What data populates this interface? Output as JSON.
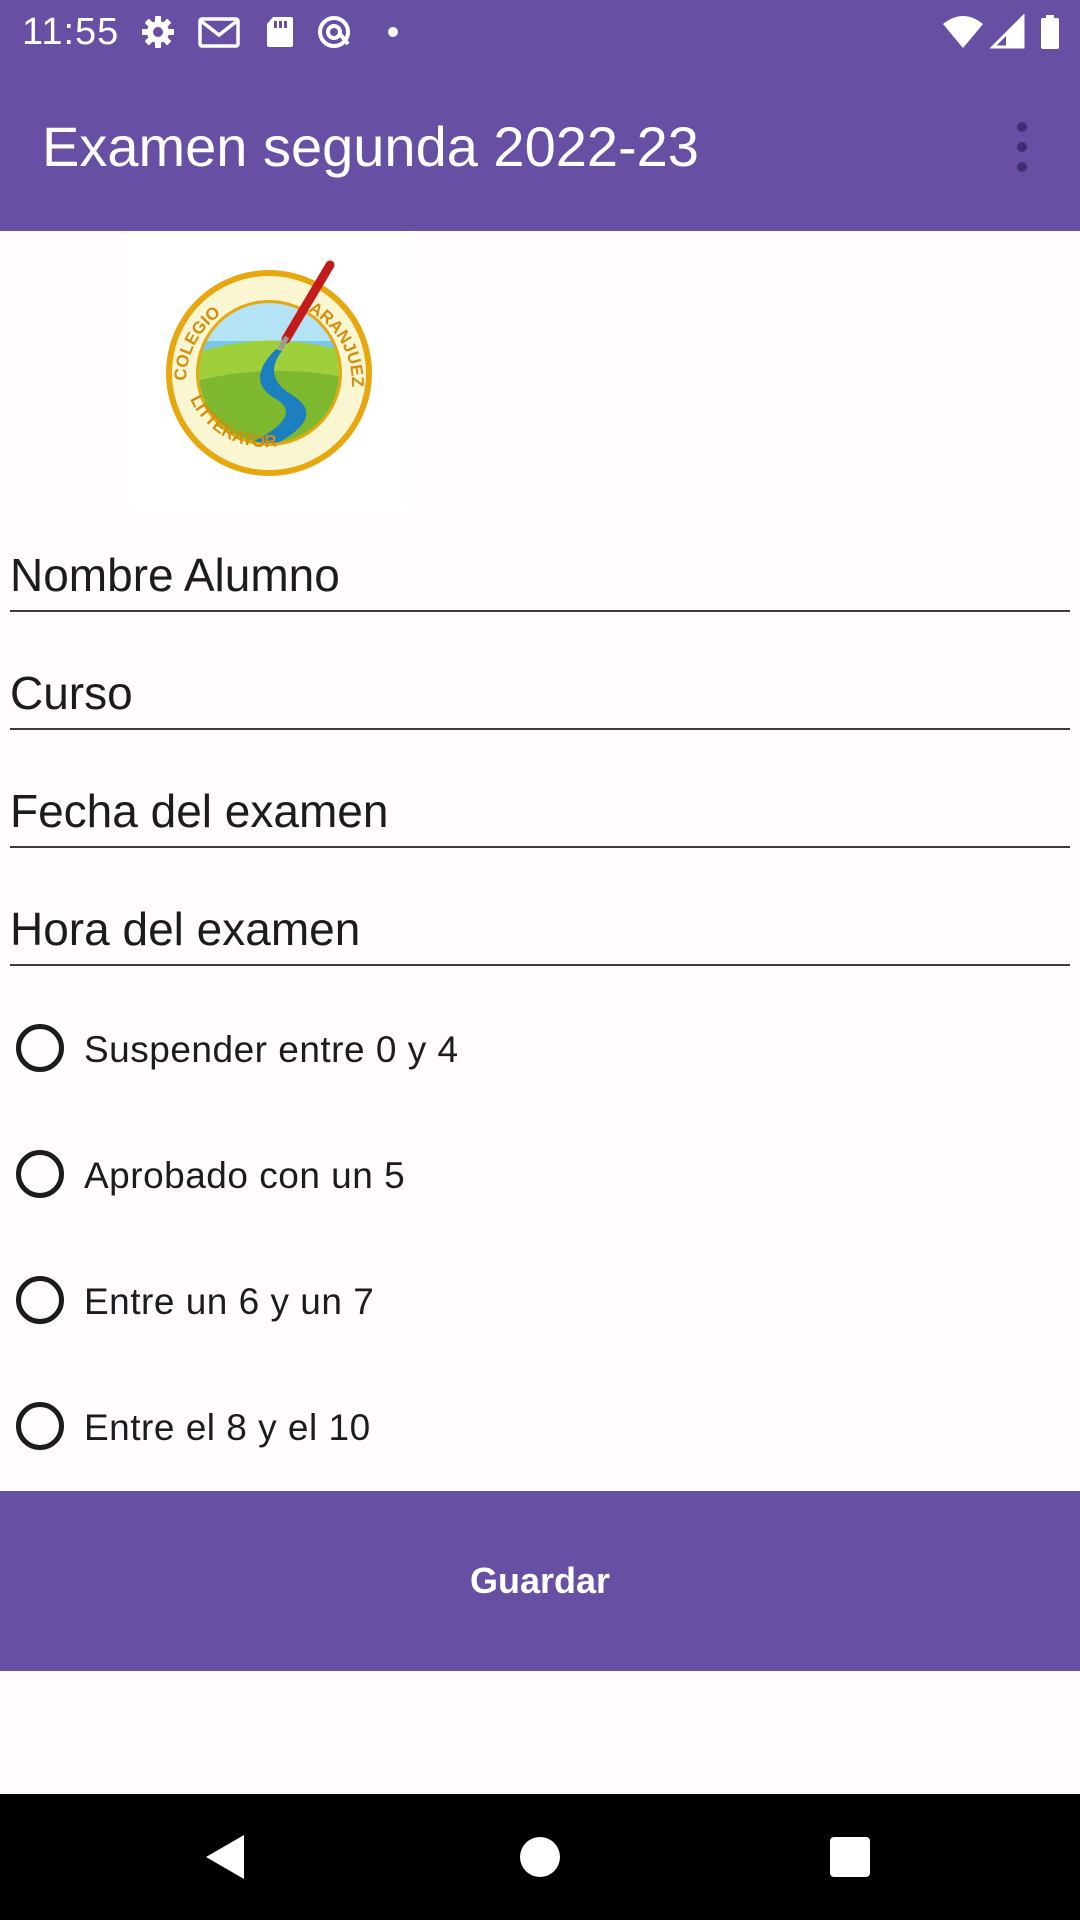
{
  "status_bar": {
    "time": "11:55",
    "icons": [
      "settings-icon",
      "gmail-icon",
      "sd-card-icon",
      "at-sign-icon",
      "dot-icon",
      "wifi-icon",
      "signal-icon",
      "battery-icon"
    ]
  },
  "app_bar": {
    "title": "Examen segunda 2022-23",
    "menu_icon": "more-vert-icon"
  },
  "logo": {
    "top_text": "COLEGIO",
    "bottom_text": "LITTERATOR",
    "right_text": "ARANJUEZ"
  },
  "form": {
    "name_placeholder": "Nombre Alumno",
    "course_placeholder": "Curso",
    "date_placeholder": "Fecha del examen",
    "time_placeholder": "Hora del examen"
  },
  "grades": {
    "options": [
      {
        "label": "Suspender entre 0 y 4",
        "selected": false
      },
      {
        "label": "Aprobado con un 5",
        "selected": false
      },
      {
        "label": "Entre un 6 y un 7",
        "selected": false
      },
      {
        "label": "Entre el 8 y el 10",
        "selected": false
      }
    ]
  },
  "actions": {
    "save_label": "Guardar"
  },
  "nav_bar": {
    "icons": [
      "back-icon",
      "home-icon",
      "recents-icon"
    ]
  },
  "colors": {
    "primary": "#6750a4",
    "surface": "#fffbfe",
    "on_surface": "#1c1b1f"
  }
}
